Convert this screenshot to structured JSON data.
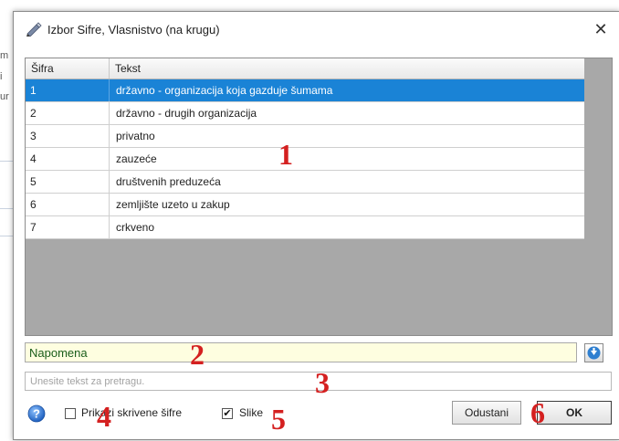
{
  "background": {
    "edge_chars": [
      "m",
      "i",
      "ur"
    ]
  },
  "dialog": {
    "title": "Izbor Sifre, Vlasnistvo (na krugu)",
    "close_glyph": "✕"
  },
  "grid": {
    "columns": [
      "Šifra",
      "Tekst"
    ],
    "rows": [
      {
        "code": "1",
        "text": "državno - organizacija koja gazduje šumama",
        "selected": true
      },
      {
        "code": "2",
        "text": "državno - drugih organizacija",
        "selected": false
      },
      {
        "code": "3",
        "text": "privatno",
        "selected": false
      },
      {
        "code": "4",
        "text": "zauzeće",
        "selected": false
      },
      {
        "code": "5",
        "text": "društvenih preduzeća",
        "selected": false
      },
      {
        "code": "6",
        "text": "zemljište uzeto u zakup",
        "selected": false
      },
      {
        "code": "7",
        "text": "crkveno",
        "selected": false
      }
    ]
  },
  "note": {
    "value": "Napomena"
  },
  "search": {
    "placeholder": "Unesite tekst za pretragu."
  },
  "options": {
    "show_hidden_label": "Prikazi skrivene šifre",
    "show_hidden_checked": false,
    "images_label": "Slike",
    "images_checked": true
  },
  "buttons": {
    "cancel": "Odustani",
    "ok": "OK"
  },
  "markers": [
    "1",
    "2",
    "3",
    "4",
    "5",
    "6"
  ],
  "colors": {
    "selection": "#1a83d6",
    "marker": "#d42020",
    "note_bg": "#fefee0"
  },
  "icons": {
    "title": "pencil-icon",
    "note_button": "down-arrow-icon",
    "help": "help-icon"
  }
}
